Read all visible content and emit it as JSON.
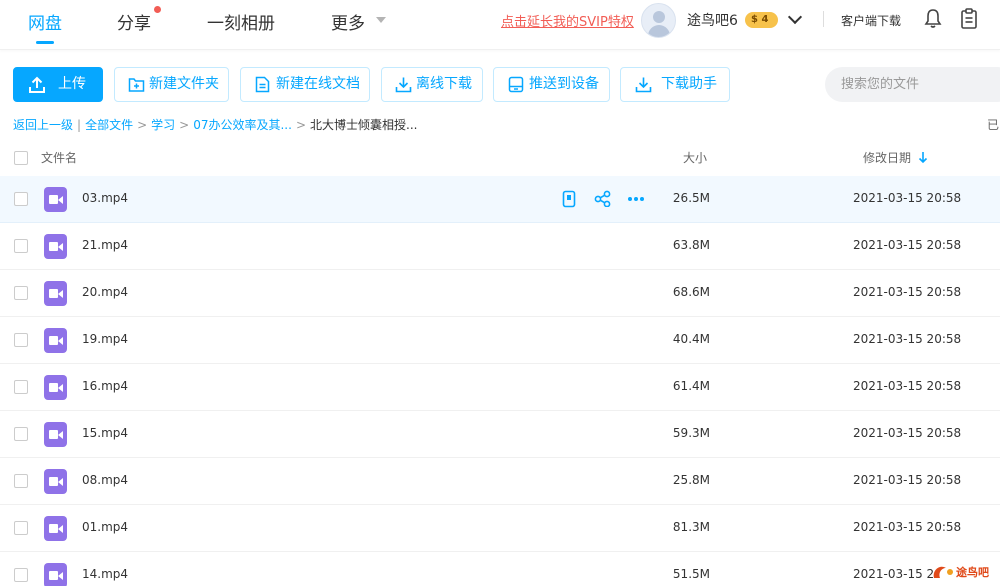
{
  "nav": {
    "items": [
      {
        "label": "网盘",
        "active": true
      },
      {
        "label": "分享"
      },
      {
        "label": "一刻相册"
      },
      {
        "label": "更多"
      }
    ],
    "svip_link": "点击延长我的SVIP特权",
    "username": "途鸟吧6",
    "vip_level": "4",
    "client_download": "客户端下载",
    "icons": [
      "bell-icon",
      "clipboard-icon"
    ],
    "accent_color": "#06a7ff",
    "dot_color": "#f25d55"
  },
  "toolbar": {
    "upload": "上传",
    "new_folder": "新建文件夹",
    "new_doc": "新建在线文档",
    "offline_download": "离线下载",
    "push_device": "推送到设备",
    "download_helper": "下载助手",
    "search_placeholder": "搜索您的文件"
  },
  "breadcrumb": {
    "back": "返回上一级",
    "all_files": "全部文件",
    "level1": "学习",
    "level2": "07办公效率及其...",
    "current": "北大博士倾囊相授...",
    "loaded": "已"
  },
  "table": {
    "headers": {
      "name": "文件名",
      "size": "大小",
      "modified": "修改日期"
    },
    "sort": "modified-desc",
    "rows": [
      {
        "name": "03.mp4",
        "size": "26.5M",
        "date": "2021-03-15 20:58",
        "hover": true
      },
      {
        "name": "21.mp4",
        "size": "63.8M",
        "date": "2021-03-15 20:58"
      },
      {
        "name": "20.mp4",
        "size": "68.6M",
        "date": "2021-03-15 20:58"
      },
      {
        "name": "19.mp4",
        "size": "40.4M",
        "date": "2021-03-15 20:58"
      },
      {
        "name": "16.mp4",
        "size": "61.4M",
        "date": "2021-03-15 20:58"
      },
      {
        "name": "15.mp4",
        "size": "59.3M",
        "date": "2021-03-15 20:58"
      },
      {
        "name": "08.mp4",
        "size": "25.8M",
        "date": "2021-03-15 20:58"
      },
      {
        "name": "01.mp4",
        "size": "81.3M",
        "date": "2021-03-15 20:58"
      },
      {
        "name": "14.mp4",
        "size": "51.5M",
        "date": "2021-03-15 2"
      }
    ],
    "row_actions": [
      "device-icon",
      "share-icon",
      "more-icon"
    ]
  },
  "watermark": {
    "text": "途鸟吧"
  }
}
